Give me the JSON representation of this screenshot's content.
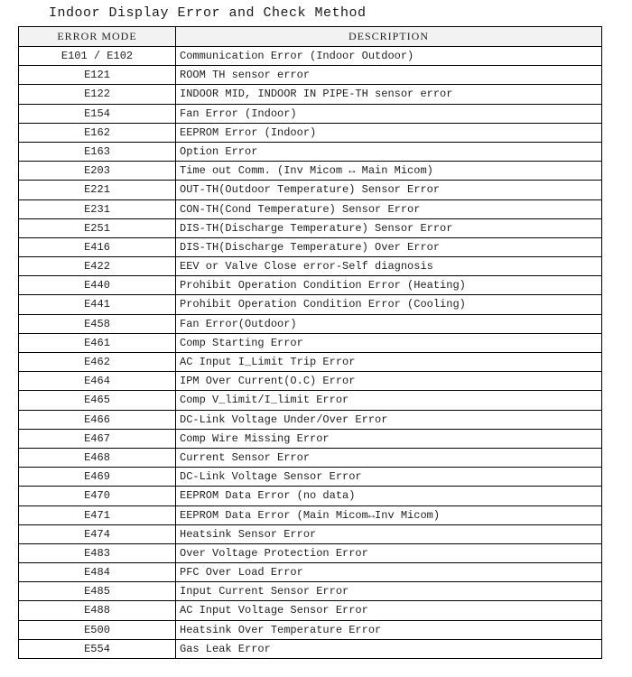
{
  "title": "Indoor Display Error and Check Method",
  "columns": {
    "mode": "ERROR MODE",
    "desc": "DESCRIPTION"
  },
  "rows": [
    {
      "mode": "E101 / E102",
      "desc": "Communication Error (Indoor Outdoor)"
    },
    {
      "mode": "E121",
      "desc": "ROOM TH sensor error"
    },
    {
      "mode": "E122",
      "desc": "INDOOR MID, INDOOR IN PIPE-TH sensor error"
    },
    {
      "mode": "E154",
      "desc": "Fan Error (Indoor)"
    },
    {
      "mode": "E162",
      "desc": "EEPROM Error (Indoor)"
    },
    {
      "mode": "E163",
      "desc": "Option Error"
    },
    {
      "mode": "E203",
      "desc": "Time out Comm. (Inv Micom ↔ Main Micom)"
    },
    {
      "mode": "E221",
      "desc": "OUT-TH(Outdoor Temperature) Sensor Error"
    },
    {
      "mode": "E231",
      "desc": "CON-TH(Cond Temperature) Sensor Error"
    },
    {
      "mode": "E251",
      "desc": "DIS-TH(Discharge Temperature) Sensor Error"
    },
    {
      "mode": "E416",
      "desc": "DIS-TH(Discharge Temperature) Over Error"
    },
    {
      "mode": "E422",
      "desc": "EEV or Valve Close error-Self diagnosis"
    },
    {
      "mode": "E440",
      "desc": "Prohibit Operation Condition Error (Heating)"
    },
    {
      "mode": "E441",
      "desc": "Prohibit Operation Condition Error (Cooling)"
    },
    {
      "mode": "E458",
      "desc": " Fan Error(Outdoor)"
    },
    {
      "mode": "E461",
      "desc": "Comp Starting Error"
    },
    {
      "mode": "E462",
      "desc": "AC Input I_Limit Trip Error"
    },
    {
      "mode": "E464",
      "desc": "IPM Over Current(O.C) Error"
    },
    {
      "mode": "E465",
      "desc": "Comp V_limit/I_limit Error"
    },
    {
      "mode": "E466",
      "desc": "DC-Link Voltage Under/Over Error"
    },
    {
      "mode": "E467",
      "desc": "Comp Wire Missing Error"
    },
    {
      "mode": "E468",
      "desc": "Current Sensor Error"
    },
    {
      "mode": "E469",
      "desc": "DC-Link Voltage Sensor Error"
    },
    {
      "mode": "E470",
      "desc": "EEPROM Data Error (no data)"
    },
    {
      "mode": "E471",
      "desc": "EEPROM Data Error (Main Micom↔Inv Micom)"
    },
    {
      "mode": "E474",
      "desc": "Heatsink Sensor Error"
    },
    {
      "mode": "E483",
      "desc": "Over Voltage Protection Error"
    },
    {
      "mode": "E484",
      "desc": "PFC Over Load Error"
    },
    {
      "mode": "E485",
      "desc": "Input Current Sensor Error"
    },
    {
      "mode": "E488",
      "desc": "AC Input Voltage Sensor Error"
    },
    {
      "mode": "E500",
      "desc": "Heatsink Over Temperature Error"
    },
    {
      "mode": "E554",
      "desc": "Gas Leak Error"
    }
  ]
}
